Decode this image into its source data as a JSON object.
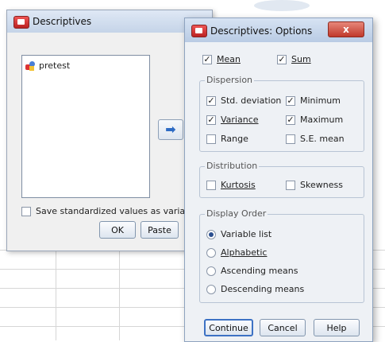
{
  "main_dialog": {
    "title": "Descriptives",
    "variables": [
      {
        "name": "pretest"
      }
    ],
    "save_label": "Save standardized values as varia",
    "buttons": {
      "ok": "OK",
      "paste": "Paste"
    }
  },
  "options_dialog": {
    "title": "Descriptives: Options",
    "close_label": "x",
    "mean_label": "Mean",
    "mean_checked": true,
    "sum_label": "Sum",
    "sum_checked": true,
    "dispersion": {
      "legend": "Dispersion",
      "std_label": "Std. deviation",
      "std_checked": true,
      "min_label": "Minimum",
      "min_checked": true,
      "variance_label": "Variance",
      "variance_checked": true,
      "max_label": "Maximum",
      "max_checked": true,
      "range_label": "Range",
      "range_checked": false,
      "se_label": "S.E. mean",
      "se_checked": false
    },
    "distribution": {
      "legend": "Distribution",
      "kurtosis_label": "Kurtosis",
      "kurtosis_checked": false,
      "skewness_label": "Skewness",
      "skewness_checked": false
    },
    "display_order": {
      "legend": "Display Order",
      "options": [
        {
          "label": "Variable list",
          "selected": true
        },
        {
          "label": "Alphabetic",
          "selected": false
        },
        {
          "label": "Ascending means",
          "selected": false
        },
        {
          "label": "Descending means",
          "selected": false
        }
      ]
    },
    "buttons": {
      "continue": "Continue",
      "cancel": "Cancel",
      "help": "Help"
    }
  },
  "colors": {
    "title_bar": "#c5d4e8",
    "accent": "#2d6bc4",
    "close": "#c0392b"
  },
  "icons": {
    "app": "spss-dialog-icon",
    "variable": "scale-variable-icon",
    "move": "right-arrow-icon"
  }
}
